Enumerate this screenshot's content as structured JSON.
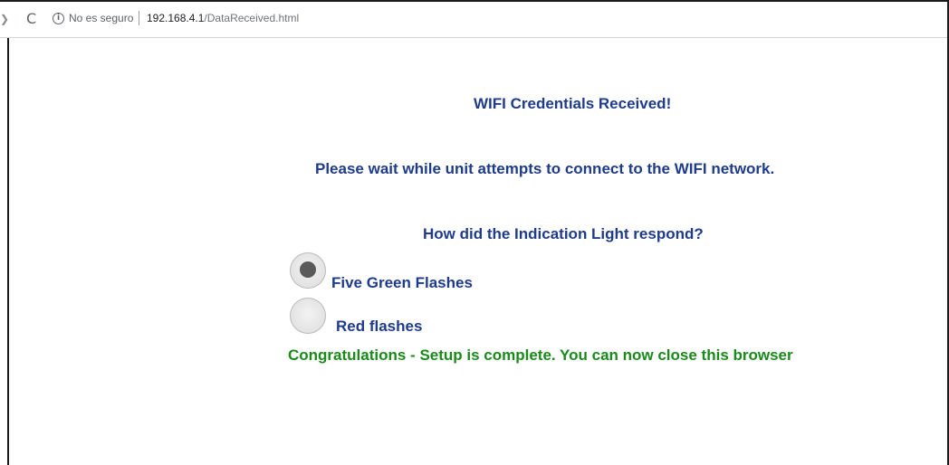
{
  "browser": {
    "security_text": "No es seguro",
    "url_host": "192.168.4.1",
    "url_path": "/DataReceived.html",
    "info_glyph": "i",
    "reload_glyph": "C"
  },
  "page": {
    "title": "WIFI Credentials Received!",
    "wait_message": "Please wait while unit attempts to connect to the WIFI network.",
    "question": "How did the Indication Light respond?",
    "options": [
      {
        "label": "Five Green Flashes",
        "selected": true
      },
      {
        "label": "Red flashes",
        "selected": false
      }
    ],
    "success_message": "Congratulations - Setup is complete. You can now close this browser"
  },
  "colors": {
    "heading": "#1f3b8c",
    "success": "#1a8a1a"
  }
}
